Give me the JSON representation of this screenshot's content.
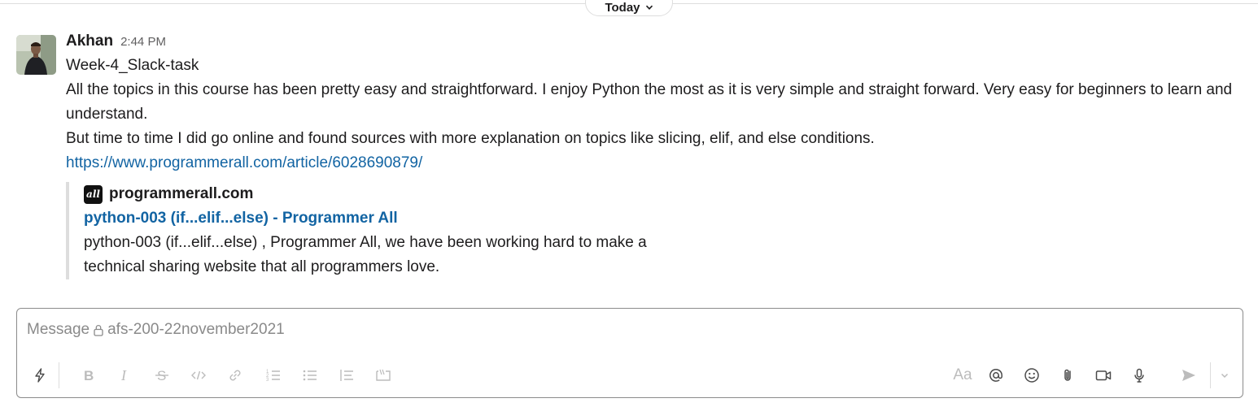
{
  "day_divider": {
    "label": "Today"
  },
  "message": {
    "author": "Akhan",
    "time": "2:44 PM",
    "lines": [
      "Week-4_Slack-task",
      "All the topics in this course has been pretty easy and straightforward. I enjoy Python the most as it is very simple and straight forward. Very easy for beginners to learn and understand.",
      "But time to time I did go online and found sources with more explanation on topics like slicing, elif, and else conditions."
    ],
    "link": "https://www.programmerall.com/article/6028690879/"
  },
  "unfurl": {
    "site_icon_text": "all",
    "site": "programmerall.com",
    "title": "python-003  (if...elif...else)   - Programmer All",
    "description_lines": [
      "python-003  (if...elif...else)  , Programmer All, we have been working hard to make a",
      "technical sharing website that all programmers love."
    ]
  },
  "composer": {
    "placeholder_prefix": "Message",
    "channel": "afs-200-22november2021",
    "format_label": "Aa"
  },
  "icons": {
    "lock": "lock-icon",
    "shortcuts": "lightning-icon",
    "bold": "bold-icon",
    "italic": "italic-icon",
    "strike": "strikethrough-icon",
    "code": "code-icon",
    "link": "link-icon",
    "ordered_list": "ordered-list-icon",
    "bullet_list": "bullet-list-icon",
    "blockquote": "blockquote-icon",
    "code_block": "code-block-icon",
    "mention": "at-icon",
    "emoji": "emoji-icon",
    "attach": "paperclip-icon",
    "video": "video-icon",
    "audio": "microphone-icon",
    "send": "send-icon",
    "send_options": "chevron-down-icon"
  },
  "colors": {
    "link": "#1264a3",
    "text": "#1d1c1d",
    "muted": "#616061"
  }
}
